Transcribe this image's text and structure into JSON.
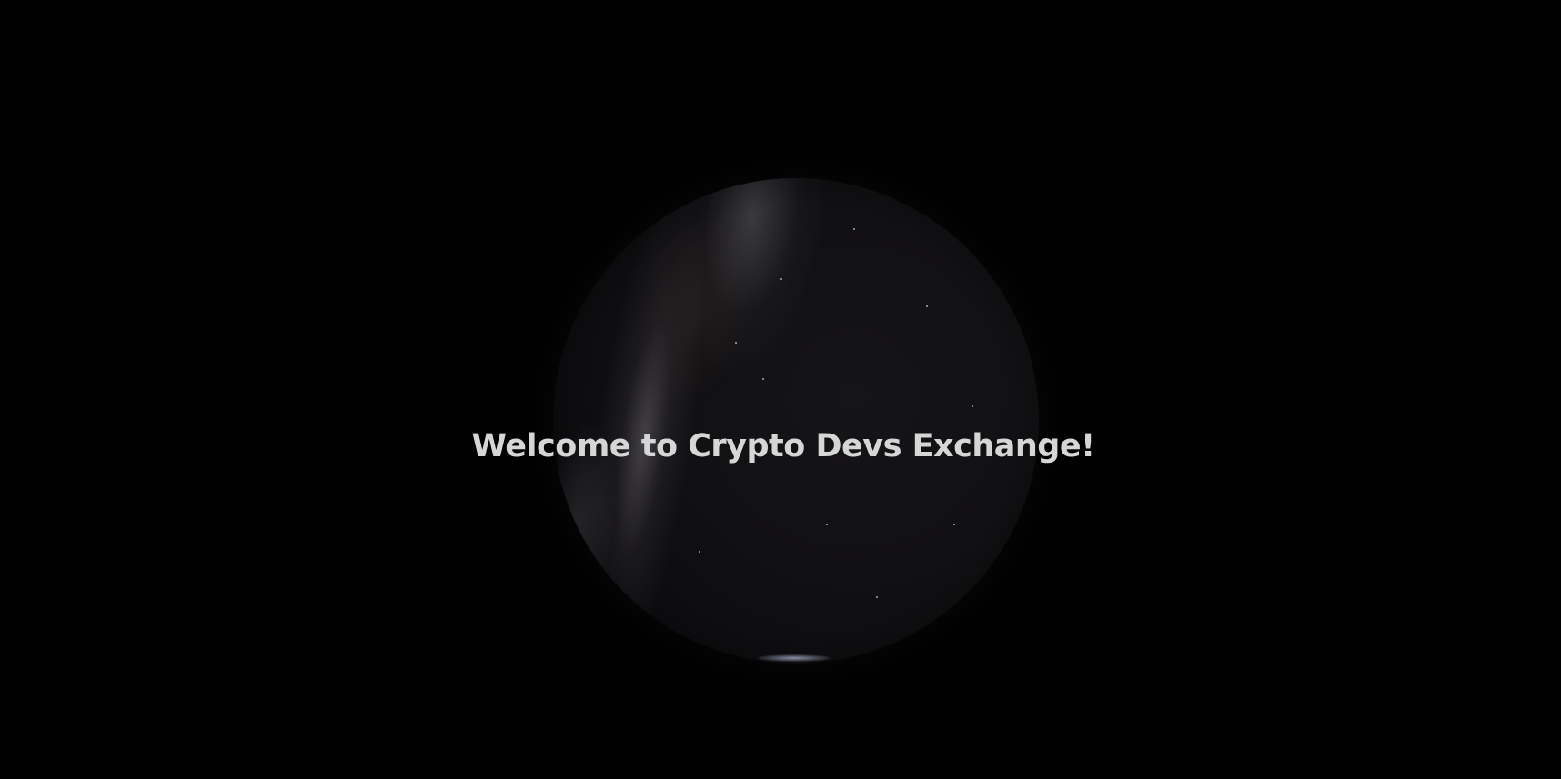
{
  "page": {
    "background_color": "#000000",
    "headline": "Welcome to Crypto Devs Exchange!",
    "headline_color": "#d6d6d6"
  },
  "globe": {
    "type": "starfield-sphere",
    "texture": "milky-way-night-sky"
  }
}
